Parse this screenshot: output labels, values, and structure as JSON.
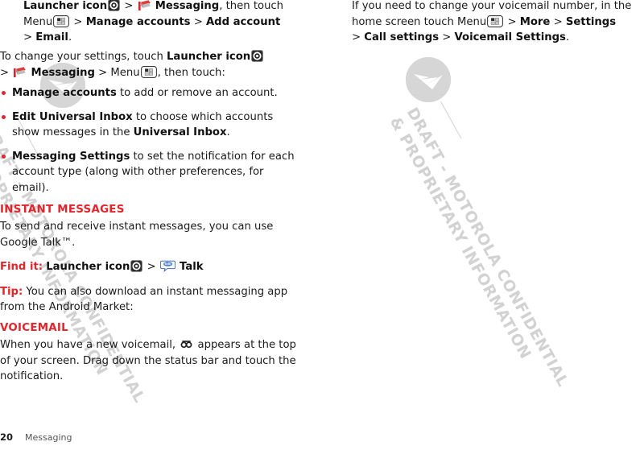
{
  "meta": {
    "accent_red": "#e1252b",
    "text_color": "#1c1c1c",
    "watermark_color": "#d2d2d2"
  },
  "watermark": {
    "line1": "DRAFT - MOTOROLA CONFIDENTIAL",
    "line2": "& PROPRIETARY INFORMATION",
    "logo_name": "motorola-batwing-logo"
  },
  "left_column": {
    "para_continued": {
      "b_launcher": "Launcher icon",
      "gt1": ">",
      "b_messaging": "Messaging",
      "after_messaging": ", then touch",
      "menu_word": "Menu",
      "gt2": ">",
      "b_manage": "Manage accounts",
      "gt3": ">",
      "b_add": "Add account",
      "gt4": ">",
      "b_email": "Email",
      "period": "."
    },
    "para_settings": {
      "lead": "To change your settings, touch",
      "b_launcher": "Launcher icon",
      "gt1": ">",
      "b_messaging": "Messaging",
      "gt2": ">",
      "menu_word": "Menu",
      "tail": ", then touch:"
    },
    "bullets": [
      {
        "bold": "Manage accounts",
        "rest": " to add or remove an account."
      },
      {
        "bold": "Edit Universal Inbox",
        "rest": " to choose which accounts show messages in the ",
        "bold2": "Universal Inbox",
        "rest2": "."
      },
      {
        "bold": "Messaging Settings",
        "rest": " to set the notification for each account type (along with other preferences, for email)."
      }
    ],
    "instant_messages": {
      "heading": "Instant messages",
      "para": "To send and receive instant messages, you can use Google Talk™.",
      "find_it_label": "Find it:",
      "find_it_launcher": "Launcher icon",
      "find_it_gt": ">",
      "find_it_talk": "Talk",
      "tip_label": "Tip:",
      "tip_text": " You can also download an instant messaging app from the Android Market:"
    },
    "voicemail": {
      "heading": "Voicemail",
      "part1": "When you have a new voicemail, ",
      "part2": " appears at the top of your screen. Drag down the status bar and touch the notification."
    }
  },
  "right_column": {
    "para_voicemail_number": {
      "lead": "If you need to change your voicemail number, in the home screen touch",
      "menu_word": "Menu",
      "gt1": ">",
      "b_more": "More",
      "gt2": ">",
      "b_settings": "Settings",
      "gt3": ">",
      "b_call": "Call settings",
      "gt4": ">",
      "b_vm_settings": "Voicemail Settings",
      "period": "."
    }
  },
  "footer": {
    "page_number": "20",
    "chapter": "Messaging"
  },
  "icons": {
    "launcher": "launcher-icon",
    "messaging": "messaging-mailbox-icon",
    "menu": "menu-grid-icon",
    "talk": "google-talk-icon",
    "voicemail": "voicemail-tape-icon"
  }
}
